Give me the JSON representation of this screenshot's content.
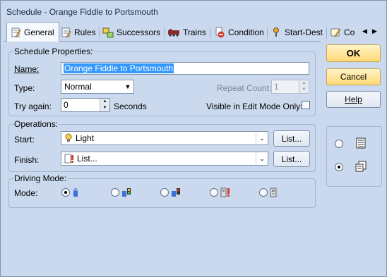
{
  "window": {
    "title": "Schedule - Orange Fiddle to Portsmouth"
  },
  "tabs": [
    {
      "name": "general",
      "label": "General",
      "icon": "general-icon"
    },
    {
      "name": "rules",
      "label": "Rules",
      "icon": "rules-icon"
    },
    {
      "name": "successors",
      "label": "Successors",
      "icon": "successors-icon"
    },
    {
      "name": "trains",
      "label": "Trains",
      "icon": "trains-icon"
    },
    {
      "name": "condition",
      "label": "Condition",
      "icon": "condition-icon"
    },
    {
      "name": "start-dest",
      "label": "Start-Dest",
      "icon": "start-dest-icon"
    },
    {
      "name": "comments",
      "label": "Co",
      "icon": "comments-icon"
    }
  ],
  "schedule_properties": {
    "group_title": "Schedule Properties:",
    "name_label": "Name:",
    "name_value": "Orange Fiddle to Portsmouth",
    "type_label": "Type:",
    "type_value": "Normal",
    "repeat_label": "Repeat Count:",
    "repeat_value": "1",
    "try_again_label": "Try again:",
    "try_again_value": "0",
    "seconds_label": "Seconds",
    "visible_label": "Visible in Edit Mode Only:"
  },
  "operations": {
    "group_title": "Operations:",
    "start_label": "Start:",
    "start_value": "Light",
    "finish_label": "Finish:",
    "finish_value": "List...",
    "list_button": "List..."
  },
  "driving_mode": {
    "group_title": "Driving Mode:",
    "mode_label": "Mode:",
    "selected_index": 0
  },
  "buttons": {
    "ok": "OK",
    "cancel": "Cancel",
    "help": "Help"
  },
  "view_options": {
    "selected_index": 1
  },
  "colors": {
    "background": "#cad9ee",
    "selection": "#3399ff",
    "ok_button": "#ffd977"
  }
}
